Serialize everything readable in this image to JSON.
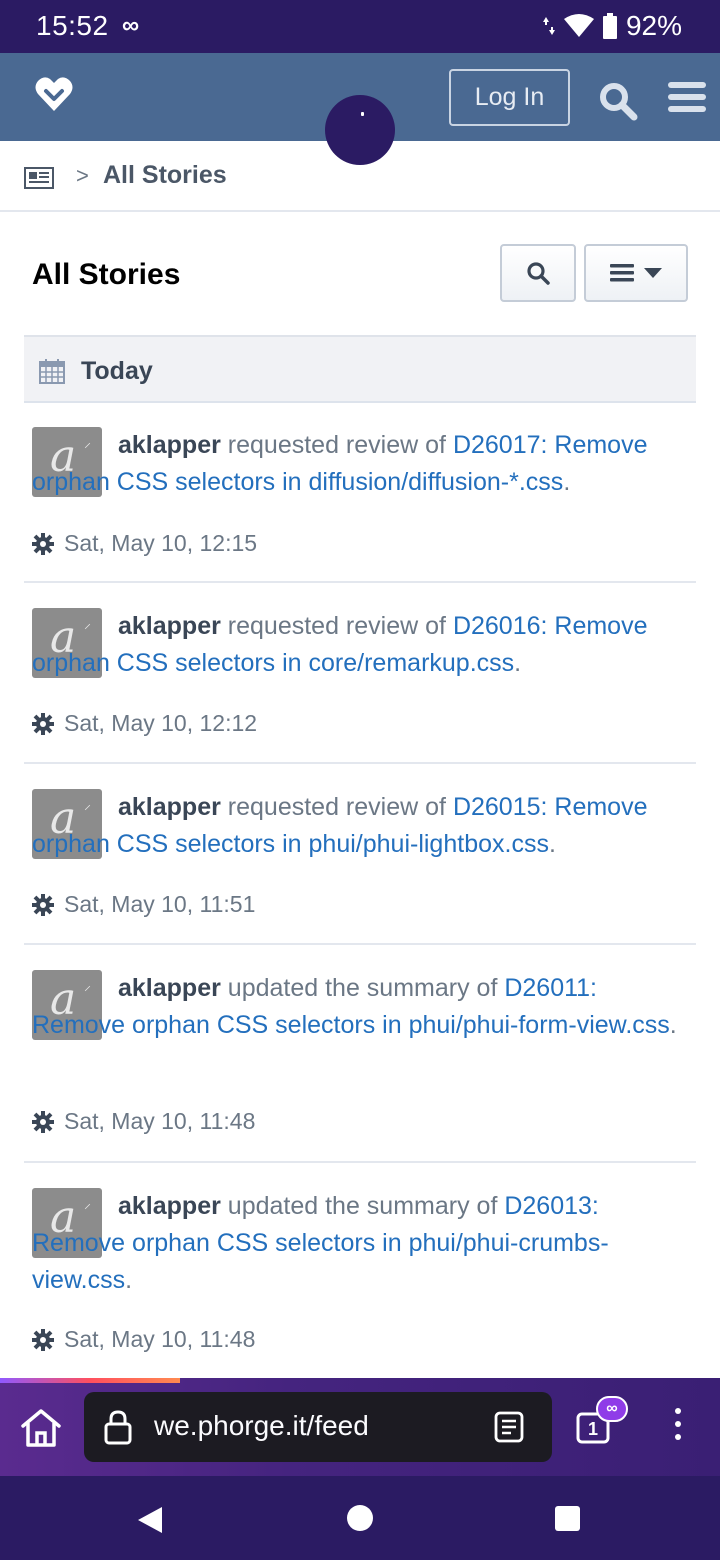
{
  "status_bar": {
    "time": "15:52",
    "infinity_symbol": "∞",
    "battery": "92%",
    "icons": [
      "data-arrows-icon",
      "wifi-icon",
      "battery-icon"
    ]
  },
  "header": {
    "logo_icon": "heart-logo-icon",
    "login_label": "Log In",
    "search_icon": "search-icon",
    "menu_icon": "hamburger-menu-icon",
    "bg_color": "#4a6992"
  },
  "breadcrumb": {
    "icon": "newspaper-icon",
    "separator": ">",
    "label": "All Stories"
  },
  "page": {
    "title": "All Stories",
    "search_button_icon": "search-icon",
    "menu_button_icon": "list-dropdown-icon"
  },
  "feed": {
    "day_header": "Today",
    "day_icon": "calendar-icon",
    "stories": [
      {
        "author": "aklapper",
        "action": "requested review of",
        "object": "D26017: Remove orphan CSS selectors in diffusion/diffusion-*.css",
        "period": ".",
        "time": "Sat, May 10, 12:15"
      },
      {
        "author": "aklapper",
        "action": "requested review of",
        "object": "D26016: Remove orphan CSS selectors in core/remarkup.css",
        "period": ".",
        "time": "Sat, May 10, 12:12"
      },
      {
        "author": "aklapper",
        "action": "requested review of",
        "object": "D26015: Remove orphan CSS selectors in phui/phui-lightbox.css",
        "period": ".",
        "time": "Sat, May 10, 11:51"
      },
      {
        "author": "aklapper",
        "action": "updated the summary of",
        "object": "D26011: Remove orphan CSS selectors in phui/phui-form-view.css",
        "period": ".",
        "time": "Sat, May 10, 11:48"
      },
      {
        "author": "aklapper",
        "action": "updated the summary of",
        "object": "D26013: Remove orphan CSS selectors in phui/phui-crumbs-view.css",
        "period": ".",
        "time": "Sat, May 10, 11:48"
      }
    ]
  },
  "browser": {
    "url": "we.phorge.it/feed",
    "tab_count": "1",
    "private_badge": "∞",
    "icons": [
      "home-icon",
      "lock-icon",
      "reader-mode-icon",
      "tabs-icon",
      "more-menu-icon"
    ]
  },
  "nav_bar": {
    "icons": [
      "back-icon",
      "home-circle-icon",
      "recent-apps-icon"
    ]
  }
}
